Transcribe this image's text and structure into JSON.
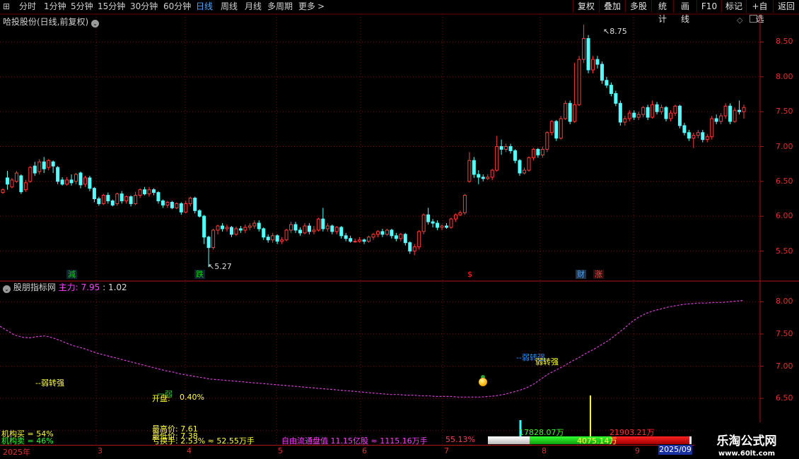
{
  "toolbar": {
    "menu_glyph": "⊞",
    "periods": [
      "分时",
      "1分钟",
      "5分钟",
      "15分钟",
      "30分钟",
      "60分钟",
      "日线",
      "周线",
      "月线",
      "多周期",
      "更多"
    ],
    "more_arrow": ">",
    "right_buttons": [
      "复权",
      "叠加",
      "多股",
      "统计",
      "画线",
      "F10",
      "标记",
      "+自选",
      "返回"
    ]
  },
  "main": {
    "title": "哈投股份(日线,前复权)",
    "y_ticks": [
      "8.50",
      "8.00",
      "7.50",
      "7.00",
      "6.50",
      "6.00",
      "5.50"
    ],
    "high_label": "8.75",
    "low_label": "5.27",
    "signals": [
      {
        "text": "減",
        "color": "#00d000"
      },
      {
        "text": "跌",
        "color": "#00d000"
      },
      {
        "text": "$",
        "color": "#ff2020"
      },
      {
        "text": "财",
        "color": "#40a0ff"
      },
      {
        "text": "涨",
        "color": "#ff4040"
      }
    ]
  },
  "sub": {
    "title": "股朋指标网",
    "main_label": "主力:",
    "main_value": "7.95",
    "ratio": ": 1.02",
    "y_ticks": [
      "8.00",
      "7.50",
      "7.00",
      "6.50",
      "6.00"
    ],
    "tag_weak_left": "--弱转强",
    "tag_weak_right_a": "--弱转强",
    "tag_weak_right_b": "弱转强",
    "open_label": "开盘:",
    "open_value": "0.40%",
    "open_ghost": "一弱",
    "inst_buy": "机构买 = 54%",
    "inst_sell": "机构卖 = 46%",
    "high_price": "最高价: 7.61",
    "low_price": "最低价: 7.38",
    "turnover": "换手: 2.53% ≈ 52.55万手",
    "turnover_pre": "亏",
    "float_cap": "自由流通盘值 11.15亿股 ≈ 1115.16万手",
    "ratio_pct": "55.13%",
    "vol_green": "17828.07万",
    "vol_mid": "4075.14万",
    "vol_red": "21903.21万"
  },
  "xaxis": {
    "labels": [
      "2025年",
      "3",
      "4",
      "5",
      "6",
      "7",
      "8",
      "9"
    ],
    "end_label": "2025/09"
  },
  "watermark": {
    "title": "乐淘公式网",
    "url": "www.60lt.com"
  },
  "colors": {
    "up": "#ff3c3c",
    "down": "#54ffff",
    "grid": "#7a1010",
    "border": "#b01414",
    "accent": "#ffd34a"
  },
  "chart_data": {
    "type": "candlestick",
    "title": "哈投股份(日线,前复权)",
    "ylim": [
      5.1,
      8.9
    ],
    "candles": [
      [
        6.34,
        6.38,
        6.32,
        6.4
      ],
      [
        6.55,
        6.46,
        6.38,
        6.65
      ],
      [
        6.42,
        6.52,
        6.4,
        6.55
      ],
      [
        6.5,
        6.62,
        6.48,
        6.65
      ],
      [
        6.58,
        6.35,
        6.32,
        6.6
      ],
      [
        6.38,
        6.48,
        6.35,
        6.52
      ],
      [
        6.5,
        6.7,
        6.48,
        6.72
      ],
      [
        6.72,
        6.62,
        6.58,
        6.78
      ],
      [
        6.64,
        6.78,
        6.6,
        6.82
      ],
      [
        6.78,
        6.68,
        6.62,
        6.85
      ],
      [
        6.7,
        6.8,
        6.66,
        6.82
      ],
      [
        6.78,
        6.72,
        6.62,
        6.8
      ],
      [
        6.7,
        6.5,
        6.46,
        6.72
      ],
      [
        6.52,
        6.46,
        6.44,
        6.56
      ],
      [
        6.46,
        6.52,
        6.44,
        6.56
      ],
      [
        6.52,
        6.48,
        6.44,
        6.6
      ],
      [
        6.5,
        6.6,
        6.46,
        6.62
      ],
      [
        6.62,
        6.45,
        6.4,
        6.64
      ],
      [
        6.46,
        6.55,
        6.42,
        6.58
      ],
      [
        6.55,
        6.4,
        6.36,
        6.58
      ],
      [
        6.4,
        6.25,
        6.2,
        6.42
      ],
      [
        6.25,
        6.18,
        6.15,
        6.28
      ],
      [
        6.18,
        6.3,
        6.16,
        6.32
      ],
      [
        6.3,
        6.22,
        6.18,
        6.34
      ],
      [
        6.22,
        6.16,
        6.14,
        6.24
      ],
      [
        6.18,
        6.32,
        6.15,
        6.34
      ],
      [
        6.32,
        6.22,
        6.18,
        6.36
      ],
      [
        6.22,
        6.28,
        6.18,
        6.3
      ],
      [
        6.28,
        6.18,
        6.14,
        6.3
      ],
      [
        6.18,
        6.3,
        6.16,
        6.35
      ],
      [
        6.3,
        6.38,
        6.26,
        6.4
      ],
      [
        6.38,
        6.32,
        6.3,
        6.42
      ],
      [
        6.32,
        6.38,
        6.28,
        6.42
      ],
      [
        6.38,
        6.34,
        6.3,
        6.4
      ],
      [
        6.34,
        6.22,
        6.18,
        6.36
      ],
      [
        6.22,
        6.16,
        6.12,
        6.24
      ],
      [
        6.16,
        6.2,
        6.12,
        6.22
      ],
      [
        6.2,
        6.12,
        6.1,
        6.22
      ],
      [
        6.12,
        6.18,
        6.1,
        6.2
      ],
      [
        6.18,
        6.06,
        6.02,
        6.2
      ],
      [
        6.06,
        6.18,
        6.04,
        6.22
      ],
      [
        6.18,
        6.26,
        6.14,
        6.28
      ],
      [
        6.26,
        6.08,
        6.04,
        6.28
      ],
      [
        6.08,
        6.0,
        5.98,
        6.1
      ],
      [
        6.0,
        5.7,
        5.6,
        6.02
      ],
      [
        5.7,
        5.55,
        5.27,
        5.72
      ],
      [
        5.55,
        5.8,
        5.52,
        5.82
      ],
      [
        5.8,
        5.86,
        5.74,
        5.88
      ],
      [
        5.86,
        5.82,
        5.78,
        5.9
      ],
      [
        5.82,
        5.84,
        5.78,
        5.88
      ],
      [
        5.84,
        5.74,
        5.7,
        5.86
      ],
      [
        5.74,
        5.82,
        5.72,
        5.85
      ],
      [
        5.82,
        5.8,
        5.76,
        5.86
      ],
      [
        5.8,
        5.84,
        5.76,
        5.88
      ],
      [
        5.84,
        5.86,
        5.8,
        5.9
      ],
      [
        5.86,
        5.9,
        5.82,
        5.94
      ],
      [
        5.9,
        5.82,
        5.78,
        5.94
      ],
      [
        5.82,
        5.7,
        5.66,
        5.84
      ],
      [
        5.7,
        5.66,
        5.62,
        5.74
      ],
      [
        5.66,
        5.72,
        5.62,
        5.76
      ],
      [
        5.72,
        5.64,
        5.6,
        5.74
      ],
      [
        5.64,
        5.66,
        5.6,
        5.7
      ],
      [
        5.66,
        5.8,
        5.64,
        5.82
      ],
      [
        5.8,
        5.88,
        5.76,
        5.92
      ],
      [
        5.88,
        5.8,
        5.76,
        5.92
      ],
      [
        5.8,
        5.76,
        5.72,
        5.84
      ],
      [
        5.76,
        5.86,
        5.74,
        5.9
      ],
      [
        5.86,
        5.78,
        5.74,
        5.9
      ],
      [
        5.78,
        5.8,
        5.74,
        5.86
      ],
      [
        5.8,
        5.96,
        5.78,
        5.98
      ],
      [
        5.96,
        5.82,
        5.78,
        6.12
      ],
      [
        5.82,
        5.86,
        5.78,
        5.9
      ],
      [
        5.86,
        5.78,
        5.74,
        5.88
      ],
      [
        5.78,
        5.84,
        5.74,
        5.86
      ],
      [
        5.84,
        5.72,
        5.68,
        5.86
      ],
      [
        5.72,
        5.68,
        5.64,
        5.76
      ],
      [
        5.68,
        5.64,
        5.62,
        5.72
      ],
      [
        5.64,
        5.64,
        5.62,
        5.68
      ],
      [
        5.64,
        5.66,
        5.62,
        5.7
      ],
      [
        5.66,
        5.64,
        5.6,
        5.68
      ],
      [
        5.64,
        5.7,
        5.62,
        5.72
      ],
      [
        5.7,
        5.74,
        5.66,
        5.76
      ],
      [
        5.74,
        5.78,
        5.7,
        5.8
      ],
      [
        5.78,
        5.74,
        5.7,
        5.82
      ],
      [
        5.74,
        5.8,
        5.72,
        5.82
      ],
      [
        5.8,
        5.72,
        5.68,
        5.82
      ],
      [
        5.72,
        5.68,
        5.64,
        5.76
      ],
      [
        5.68,
        5.74,
        5.64,
        5.76
      ],
      [
        5.74,
        5.62,
        5.58,
        5.76
      ],
      [
        5.62,
        5.5,
        5.46,
        5.64
      ],
      [
        5.5,
        5.56,
        5.44,
        5.6
      ],
      [
        5.56,
        5.78,
        5.52,
        5.8
      ],
      [
        5.78,
        6.02,
        5.74,
        6.04
      ],
      [
        6.02,
        5.92,
        5.88,
        6.12
      ],
      [
        5.92,
        5.9,
        5.84,
        5.96
      ],
      [
        5.9,
        5.84,
        5.8,
        5.94
      ],
      [
        5.84,
        5.86,
        5.8,
        5.88
      ],
      [
        5.86,
        5.84,
        5.82,
        5.9
      ],
      [
        5.84,
        5.96,
        5.82,
        5.98
      ],
      [
        5.96,
        6.02,
        5.92,
        6.04
      ],
      [
        6.02,
        6.05,
        6.0,
        6.08
      ],
      [
        6.05,
        6.3,
        6.02,
        6.32
      ],
      [
        6.5,
        6.8,
        6.48,
        6.92
      ],
      [
        6.8,
        6.6,
        6.55,
        6.85
      ],
      [
        6.6,
        6.56,
        6.46,
        6.66
      ],
      [
        6.56,
        6.54,
        6.5,
        6.6
      ],
      [
        6.54,
        6.56,
        6.52,
        6.6
      ],
      [
        6.56,
        6.66,
        6.52,
        6.68
      ],
      [
        6.66,
        7.0,
        6.64,
        7.15
      ],
      [
        7.0,
        6.96,
        6.88,
        7.1
      ],
      [
        6.96,
        7.0,
        6.92,
        7.04
      ],
      [
        7.0,
        6.94,
        6.9,
        7.04
      ],
      [
        6.94,
        6.8,
        6.76,
        6.96
      ],
      [
        6.8,
        6.62,
        6.58,
        6.82
      ],
      [
        6.62,
        6.66,
        6.6,
        6.7
      ],
      [
        6.66,
        6.84,
        6.64,
        6.86
      ],
      [
        6.84,
        6.96,
        6.8,
        6.98
      ],
      [
        6.96,
        6.88,
        6.84,
        6.98
      ],
      [
        6.88,
        6.96,
        6.84,
        7.0
      ],
      [
        6.96,
        7.2,
        6.92,
        7.22
      ],
      [
        7.2,
        7.36,
        7.16,
        7.38
      ],
      [
        7.36,
        7.12,
        7.08,
        7.38
      ],
      [
        7.12,
        7.4,
        7.1,
        7.44
      ],
      [
        7.4,
        7.62,
        7.38,
        7.66
      ],
      [
        7.62,
        7.36,
        7.32,
        7.66
      ],
      [
        7.36,
        7.6,
        7.34,
        8.2
      ],
      [
        7.6,
        8.25,
        7.58,
        8.3
      ],
      [
        8.25,
        8.55,
        8.2,
        8.75
      ],
      [
        8.55,
        8.1,
        8.05,
        8.6
      ],
      [
        8.1,
        8.25,
        8.05,
        8.3
      ],
      [
        8.25,
        8.18,
        8.12,
        8.3
      ],
      [
        8.18,
        7.95,
        7.9,
        8.22
      ],
      [
        7.95,
        7.88,
        7.84,
        8.0
      ],
      [
        7.88,
        7.76,
        7.72,
        7.92
      ],
      [
        7.76,
        7.62,
        7.58,
        7.8
      ],
      [
        7.62,
        7.35,
        7.3,
        7.66
      ],
      [
        7.35,
        7.4,
        7.3,
        7.44
      ],
      [
        7.4,
        7.48,
        7.36,
        7.52
      ],
      [
        7.48,
        7.42,
        7.38,
        7.52
      ],
      [
        7.42,
        7.46,
        7.38,
        7.5
      ],
      [
        7.46,
        7.56,
        7.42,
        7.58
      ],
      [
        7.56,
        7.42,
        7.38,
        7.6
      ],
      [
        7.42,
        7.6,
        7.4,
        7.66
      ],
      [
        7.6,
        7.5,
        7.46,
        7.64
      ],
      [
        7.5,
        7.56,
        7.46,
        7.6
      ],
      [
        7.56,
        7.4,
        7.36,
        7.58
      ],
      [
        7.4,
        7.48,
        7.36,
        7.52
      ],
      [
        7.48,
        7.58,
        7.44,
        7.6
      ],
      [
        7.58,
        7.3,
        7.26,
        7.6
      ],
      [
        7.3,
        7.2,
        7.16,
        7.34
      ],
      [
        7.2,
        7.12,
        7.08,
        7.24
      ],
      [
        7.12,
        7.16,
        6.98,
        7.2
      ],
      [
        7.16,
        7.2,
        7.12,
        7.24
      ],
      [
        7.2,
        7.1,
        7.06,
        7.24
      ],
      [
        7.1,
        7.14,
        7.06,
        7.18
      ],
      [
        7.14,
        7.4,
        7.1,
        7.44
      ],
      [
        7.4,
        7.36,
        7.32,
        7.46
      ],
      [
        7.36,
        7.44,
        7.32,
        7.48
      ],
      [
        7.44,
        7.58,
        7.4,
        7.62
      ],
      [
        7.58,
        7.36,
        7.32,
        7.62
      ],
      [
        7.36,
        7.52,
        7.34,
        7.56
      ],
      [
        7.52,
        7.5,
        7.46,
        7.66
      ],
      [
        7.5,
        7.56,
        7.4,
        7.6
      ]
    ],
    "sub_series": {
      "name": "主力",
      "ylim": [
        5.8,
        8.3
      ],
      "values": [
        7.62,
        7.55,
        7.48,
        7.45,
        7.44,
        7.46,
        7.47,
        7.44,
        7.4,
        7.35,
        7.31,
        7.28,
        7.24,
        7.2,
        7.17,
        7.14,
        7.11,
        7.08,
        7.05,
        7.02,
        6.99,
        6.96,
        6.93,
        6.91,
        6.88,
        6.86,
        6.84,
        6.82,
        6.8,
        6.79,
        6.78,
        6.77,
        6.76,
        6.75,
        6.74,
        6.73,
        6.72,
        6.71,
        6.7,
        6.69,
        6.68,
        6.67,
        6.66,
        6.65,
        6.64,
        6.63,
        6.62,
        6.61,
        6.6,
        6.59,
        6.58,
        6.57,
        6.56,
        6.56,
        6.55,
        6.55,
        6.54,
        6.54,
        6.53,
        6.53,
        6.53,
        6.52,
        6.52,
        6.52,
        6.52,
        6.53,
        6.54,
        6.56,
        6.59,
        6.62,
        6.66,
        6.72,
        6.8,
        6.88,
        6.94,
        7.0,
        7.07,
        7.13,
        7.2,
        7.26,
        7.33,
        7.4,
        7.49,
        7.58,
        7.68,
        7.76,
        7.82,
        7.86,
        7.89,
        7.92,
        7.94,
        7.96,
        7.97,
        7.98,
        7.98,
        7.99,
        7.99,
        8.0,
        8.01,
        8.02
      ]
    }
  }
}
